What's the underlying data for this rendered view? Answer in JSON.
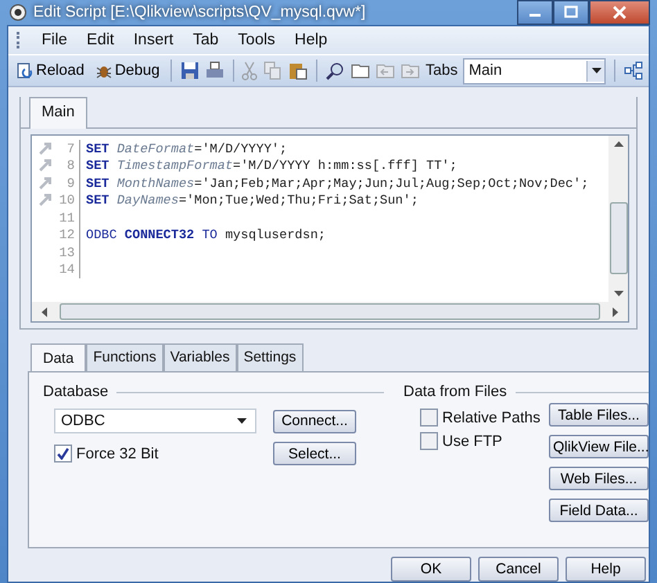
{
  "window": {
    "title": "Edit Script [E:\\Qlikview\\scripts\\QV_mysql.qvw*]"
  },
  "menu": [
    "File",
    "Edit",
    "Insert",
    "Tab",
    "Tools",
    "Help"
  ],
  "toolbar": {
    "reload": "Reload",
    "debug": "Debug",
    "tabs_label": "Tabs",
    "tab_select": "Main"
  },
  "script_tabs": [
    {
      "label": "Main",
      "selected": true
    }
  ],
  "code_lines": [
    {
      "number": "7",
      "bookmark": true,
      "tokens": [
        {
          "kind": "keyword",
          "text": "SET"
        },
        {
          "kind": "variable",
          "text": " DateFormat"
        },
        {
          "kind": "text",
          "text": "='M/D/YYYY';"
        }
      ]
    },
    {
      "number": "8",
      "bookmark": true,
      "tokens": [
        {
          "kind": "keyword",
          "text": "SET"
        },
        {
          "kind": "variable",
          "text": " TimestampFormat"
        },
        {
          "kind": "text",
          "text": "='M/D/YYYY h:mm:ss[.fff] TT';"
        }
      ]
    },
    {
      "number": "9",
      "bookmark": true,
      "tokens": [
        {
          "kind": "keyword",
          "text": "SET"
        },
        {
          "kind": "variable",
          "text": " MonthNames"
        },
        {
          "kind": "text",
          "text": "='Jan;Feb;Mar;Apr;May;Jun;Jul;Aug;Sep;Oct;Nov;Dec';"
        }
      ]
    },
    {
      "number": "10",
      "bookmark": true,
      "tokens": [
        {
          "kind": "keyword",
          "text": "SET"
        },
        {
          "kind": "variable",
          "text": " DayNames"
        },
        {
          "kind": "text",
          "text": "='Mon;Tue;Wed;Thu;Fri;Sat;Sun';"
        }
      ]
    },
    {
      "number": "11",
      "bookmark": false
    },
    {
      "number": "12",
      "bookmark": false,
      "tokens": [
        {
          "kind": "command",
          "text": "ODBC "
        },
        {
          "kind": "keyword",
          "text": "CONNECT32"
        },
        {
          "kind": "command",
          "text": " TO"
        },
        {
          "kind": "text",
          "text": " mysqluserdsn;"
        }
      ]
    },
    {
      "number": "13",
      "bookmark": false
    },
    {
      "number": "14",
      "bookmark": false
    }
  ],
  "panel_tabs": [
    {
      "label": "Data",
      "selected": true
    },
    {
      "label": "Functions",
      "selected": false
    },
    {
      "label": "Variables",
      "selected": false
    },
    {
      "label": "Settings",
      "selected": false
    }
  ],
  "database": {
    "title": "Database",
    "driver": "ODBC",
    "force32": {
      "label": "Force 32 Bit",
      "checked": true
    },
    "buttons": [
      "Connect...",
      "Select..."
    ]
  },
  "files": {
    "title": "Data from Files",
    "options": [
      {
        "label": "Relative Paths",
        "checked": false
      },
      {
        "label": "Use FTP",
        "checked": false
      }
    ],
    "buttons": [
      "Table Files...",
      "QlikView File...",
      "Web Files...",
      "Field Data..."
    ]
  },
  "dialog_buttons": [
    "OK",
    "Cancel",
    "Help"
  ]
}
